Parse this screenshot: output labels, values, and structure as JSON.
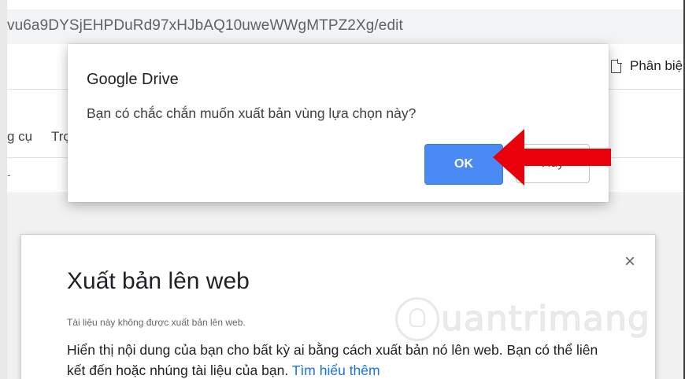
{
  "browser": {
    "url": "vu6a9DYSjEHPDuRd97xHJbAQ10uweWWgMTPZ2Xg/edit"
  },
  "app_bar": {
    "share_icon": "doc-share-icon",
    "share_label": "Phân biệ"
  },
  "menu": {
    "items": [
      "g cụ",
      "Trợ"
    ]
  },
  "toolbar": {
    "glyph": "-"
  },
  "publish_dialog": {
    "title": "Xuất bản lên web",
    "note": "Tài liệu này không được xuất bản lên web.",
    "description": "Hiển thị nội dung của bạn cho bất kỳ ai bằng cách xuất bản nó lên web. Bạn có thể liên kết đến hoặc nhúng tài liệu của bạn.",
    "learn_more": "Tìm hiểu thêm",
    "close_icon": "×"
  },
  "confirm_dialog": {
    "title": "Google Drive",
    "message": "Bạn có chắc chắn muốn xuất bản vùng lựa chọn này?",
    "ok_label": "OK",
    "cancel_label": "Hủy"
  },
  "watermark": {
    "text": "uantrimang"
  },
  "colors": {
    "ok_button": "#4a8af4",
    "arrow": "#e8000b",
    "link": "#1a73e8"
  }
}
